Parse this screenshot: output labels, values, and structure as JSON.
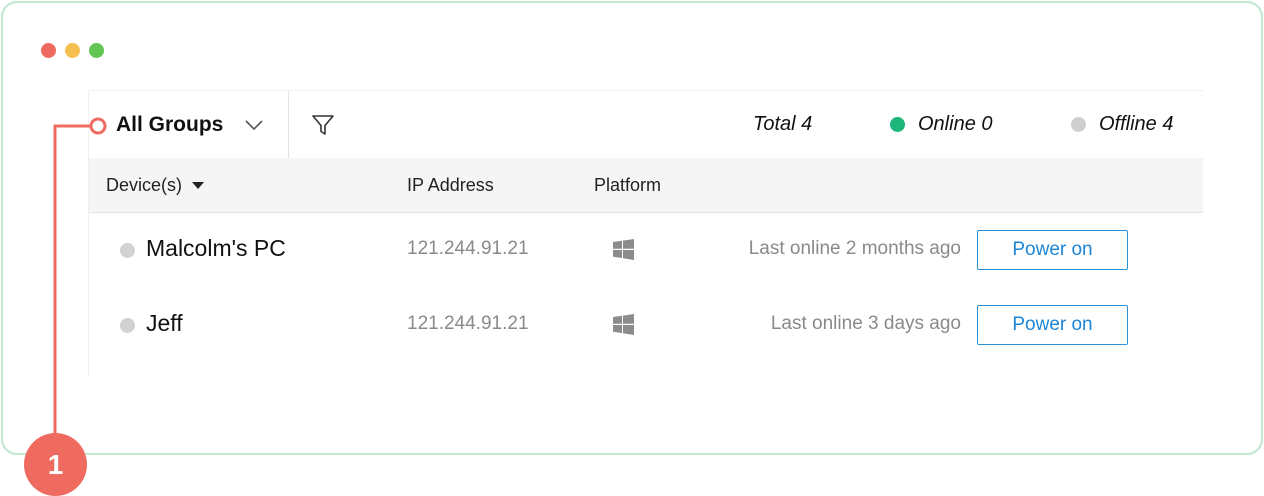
{
  "window": {
    "controls": [
      "close",
      "minimize",
      "zoom"
    ]
  },
  "toolbar": {
    "group_label": "All Groups",
    "group_icon": "chevron-down-icon",
    "filter_icon": "filter-icon",
    "stats": {
      "total": "Total 4",
      "online": "Online 0",
      "offline": "Offline 4"
    },
    "colors": {
      "online": "#1db67a",
      "offline": "#cfcfcf"
    }
  },
  "table": {
    "headers": {
      "device": "Device(s)",
      "ip": "IP Address",
      "platform": "Platform"
    },
    "rows": [
      {
        "name": "Malcolm's PC",
        "ip": "121.244.91.21",
        "platform_icon": "windows-icon",
        "last_online": "Last online 2 months ago",
        "action": "Power on"
      },
      {
        "name": "Jeff",
        "ip": "121.244.91.21",
        "platform_icon": "windows-icon",
        "last_online": "Last online 3 days ago",
        "action": "Power on"
      }
    ]
  },
  "annotation": {
    "number": "1",
    "color": "#ef6b60"
  }
}
